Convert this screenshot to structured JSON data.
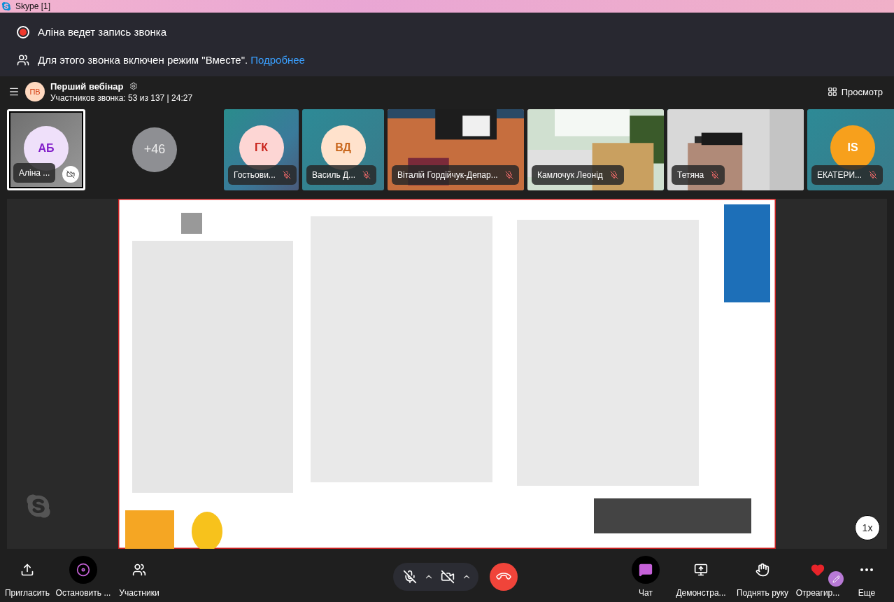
{
  "window": {
    "title": "Skype [1]"
  },
  "recording_banner": {
    "text": "Аліна ведет запись звонка",
    "recording": true
  },
  "together_banner": {
    "text": "Для этого звонка включен режим \"Вместе\".",
    "link": "Подробнее"
  },
  "call": {
    "avatar": "ПВ",
    "title": "Перший вебінар",
    "subtitle": "Участников звонка: 53 из 137 | 24:27",
    "view_button": "Просмотр"
  },
  "participants": [
    {
      "kind": "avatar",
      "initials": "АБ",
      "name": "Аліна ...",
      "color": "#efe0fa",
      "selected": true,
      "muted": false
    },
    {
      "kind": "overflow",
      "count": "+46"
    },
    {
      "kind": "avatar",
      "initials": "ГК",
      "name": "Гостьови...",
      "color": "#fdd6d4",
      "selected": false,
      "muted": true
    },
    {
      "kind": "avatar",
      "initials": "ВД",
      "name": "Василь Д...",
      "color": "#ffe2cc",
      "selected": false,
      "muted": true
    },
    {
      "kind": "video",
      "name": "Віталій Гордійчук-Депар...",
      "selected": false,
      "muted": true
    },
    {
      "kind": "video",
      "name": "Камлочук Леонід",
      "selected": false,
      "muted": true
    },
    {
      "kind": "video",
      "name": "Тетяна",
      "selected": false,
      "muted": true
    },
    {
      "kind": "avatar",
      "initials": "IS",
      "name": "ЕКАТЕРИ...",
      "color": "#f7a01c",
      "selected": false,
      "muted": true
    }
  ],
  "stage": {
    "kind": "picture",
    "speed": "1x"
  },
  "toolbar_left": [
    {
      "kind": "invite",
      "label": "Пригласить",
      "active": false
    },
    {
      "kind": "record",
      "label": "Остановить ...",
      "active": true
    },
    {
      "kind": "people",
      "label": "Участники",
      "active": false
    }
  ],
  "call_controls": {
    "mic_muted": true,
    "camera_on": false
  },
  "toolbar_right": [
    {
      "kind": "chat",
      "label": "Чат",
      "active": true
    },
    {
      "kind": "share",
      "label": "Демонстра...",
      "active": false
    },
    {
      "kind": "hand",
      "label": "Поднять руку",
      "active": false
    },
    {
      "kind": "react",
      "label": "Отреагир...",
      "active": false
    },
    {
      "kind": "more",
      "label": "Еще",
      "active": false
    }
  ]
}
